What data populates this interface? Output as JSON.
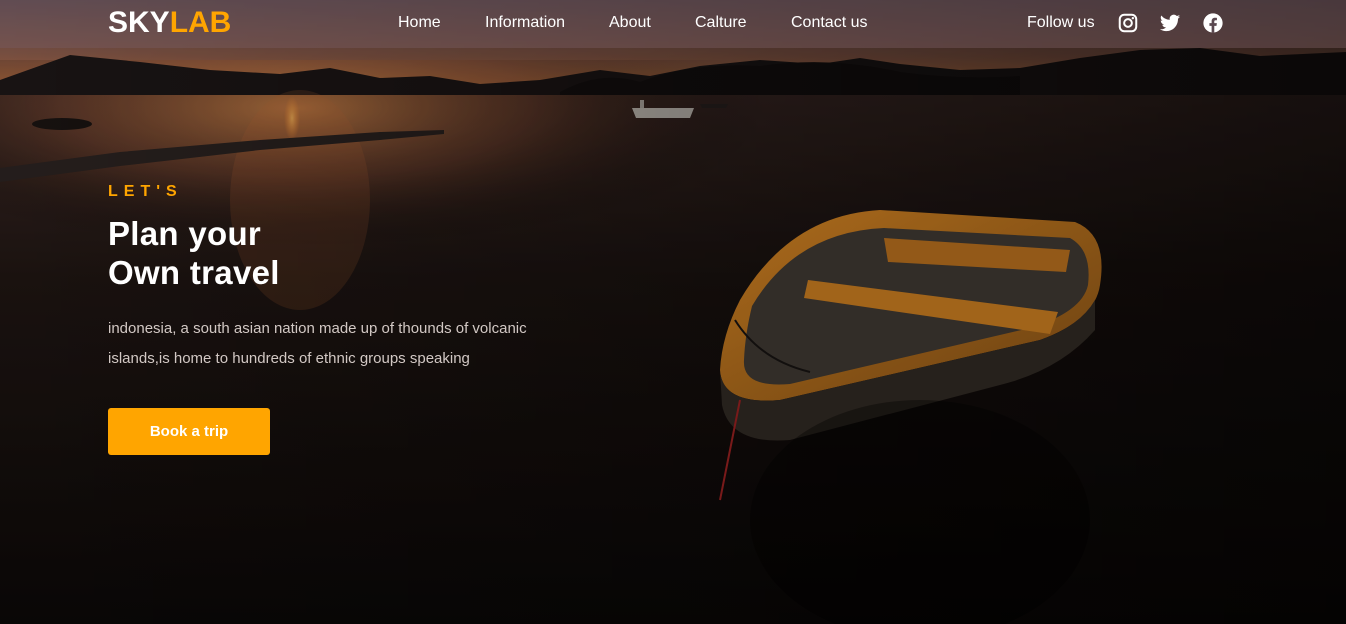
{
  "brand": {
    "part1": "SKY",
    "part2": "LAB",
    "part1_color": "#ffffff",
    "part2_color": "#ffa500"
  },
  "nav": {
    "items": [
      {
        "label": "Home"
      },
      {
        "label": "Information"
      },
      {
        "label": "About"
      },
      {
        "label": "Calture"
      },
      {
        "label": "Contact us"
      }
    ]
  },
  "social": {
    "label": "Follow us",
    "icons": [
      "instagram-icon",
      "twitter-icon",
      "facebook-icon"
    ]
  },
  "hero": {
    "eyebrow": "LET'S",
    "headline_line1": "Plan your",
    "headline_line2": "Own travel",
    "description_line1": "indonesia, a south asian nation made up of thounds of volcanic",
    "description_line2": "islands,is home to hundreds of ethnic groups speaking",
    "cta_label": "Book a trip",
    "background_image": "sunset-lake-with-wooden-rowboat"
  },
  "colors": {
    "accent": "#ffa500",
    "text": "#ffffff",
    "muted_text": "#d2c8c4"
  }
}
